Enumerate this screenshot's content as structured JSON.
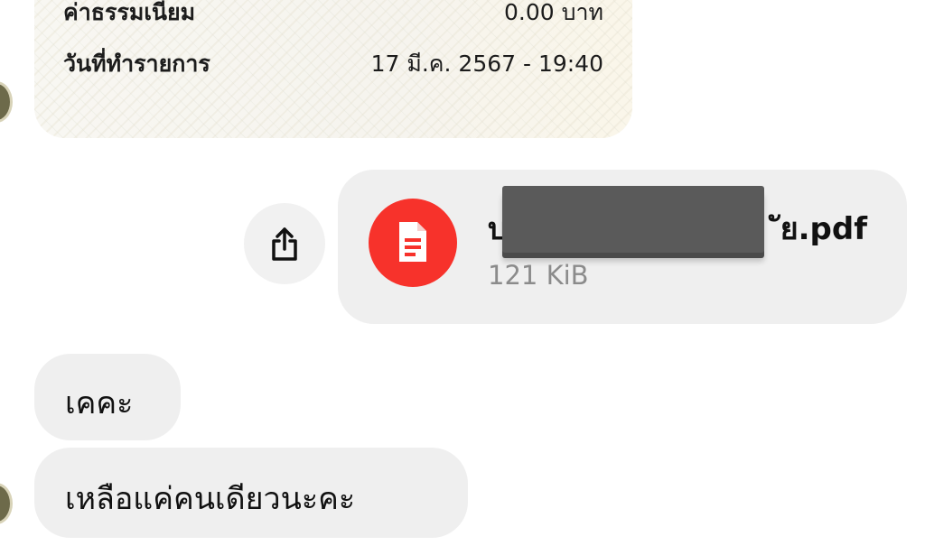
{
  "receipt": {
    "fee_label": "ค่าธรรมเนียม",
    "fee_value": "0.00 บาท",
    "date_label": "วันที่ทำรายการ",
    "date_value": "17 มี.ค. 2567 - 19:40"
  },
  "attachment": {
    "file_name_start": "บ",
    "file_name_end": "ัย.pdf",
    "file_size": "121 KiB",
    "icon": "document-icon",
    "icon_color": "#f7322b"
  },
  "share": {
    "icon": "share-icon"
  },
  "messages": [
    {
      "text": "เคคะ"
    },
    {
      "text": "เหลือแค่คนเดียวนะคะ"
    }
  ]
}
